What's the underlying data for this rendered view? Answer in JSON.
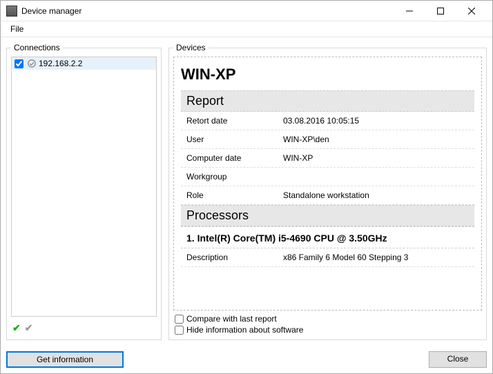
{
  "window": {
    "title": "Device manager"
  },
  "menu": {
    "file": "File"
  },
  "panels": {
    "connections": "Connections",
    "devices": "Devices"
  },
  "tree": {
    "item_ip": "192.168.2.2"
  },
  "device": {
    "name": "WIN-XP",
    "report_heading": "Report",
    "rows": {
      "report_date_k": "Retort date",
      "report_date_v": "03.08.2016 10:05:15",
      "user_k": "User",
      "user_v": "WIN-XP\\den",
      "computer_k": "Computer date",
      "computer_v": "WIN-XP",
      "workgroup_k": "Workgroup",
      "workgroup_v": "",
      "role_k": "Role",
      "role_v": "Standalone workstation"
    },
    "processors_heading": "Processors",
    "processor_item": "1. Intel(R) Core(TM) i5-4690 CPU @ 3.50GHz",
    "processor_desc_k": "Description",
    "processor_desc_v": "x86 Family 6 Model 60 Stepping 3"
  },
  "options": {
    "compare": "Compare with last report",
    "hide_software": "Hide information about software"
  },
  "buttons": {
    "get_information": "Get information",
    "close": "Close"
  }
}
